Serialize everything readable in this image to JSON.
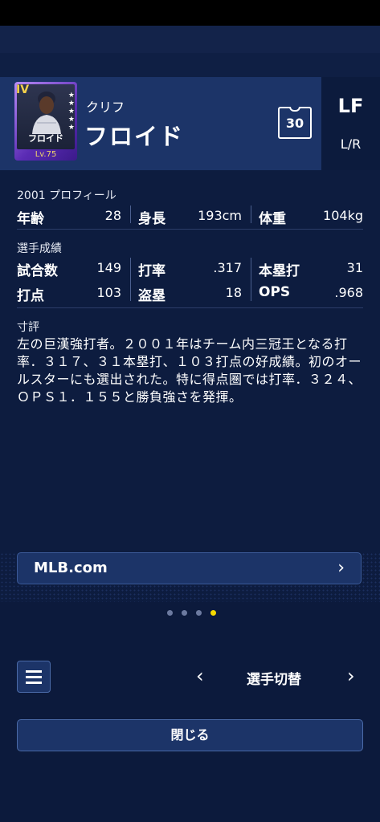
{
  "player": {
    "kana": "クリフ",
    "name": "フロイド",
    "card_name": "フロイド",
    "card_grade": "IV",
    "card_level": "Lv.75",
    "number": "30",
    "position": "LF",
    "bats_throws": "L/R"
  },
  "profile": {
    "title": "2001 プロフィール",
    "age_label": "年齢",
    "age_value": "28",
    "height_label": "身長",
    "height_value": "193cm",
    "weight_label": "体重",
    "weight_value": "104kg"
  },
  "stats": {
    "title": "選手成績",
    "games_label": "試合数",
    "games_value": "149",
    "avg_label": "打率",
    "avg_value": ".317",
    "hr_label": "本塁打",
    "hr_value": "31",
    "rbi_label": "打点",
    "rbi_value": "103",
    "sb_label": "盗塁",
    "sb_value": "18",
    "ops_label": "OPS",
    "ops_value": ".968"
  },
  "comment": {
    "title": "寸評",
    "text": "左の巨漢強打者。２００１年はチーム内三冠王となる打率．３１７、３１本塁打、１０３打点の好成績。初のオールスターにも選出された。特に得点圏では打率．３２４、ＯＰＳ１．１５５と勝負強さを発揮。"
  },
  "links": {
    "mlb_label": "MLB.com"
  },
  "pager": {
    "count": 4,
    "active": 3,
    "active_color": "#f5d800"
  },
  "footer": {
    "switch_label": "選手切替",
    "close_label": "閉じる"
  }
}
